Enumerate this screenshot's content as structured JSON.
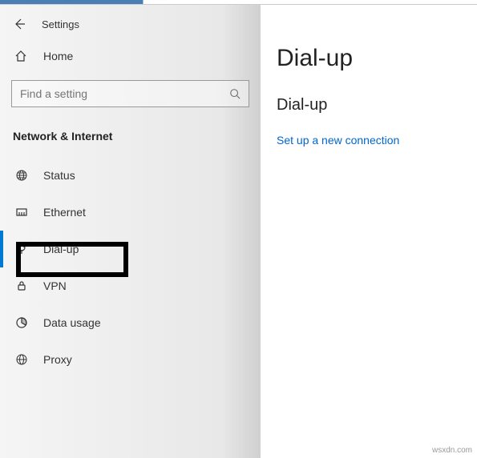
{
  "header": {
    "app_title": "Settings"
  },
  "home": {
    "label": "Home"
  },
  "search": {
    "placeholder": "Find a setting"
  },
  "section": {
    "title": "Network & Internet"
  },
  "nav": {
    "items": [
      {
        "label": "Status"
      },
      {
        "label": "Ethernet"
      },
      {
        "label": "Dial-up"
      },
      {
        "label": "VPN"
      },
      {
        "label": "Data usage"
      },
      {
        "label": "Proxy"
      }
    ]
  },
  "content": {
    "page_title": "Dial-up",
    "sub_heading": "Dial-up",
    "link_text": "Set up a new connection"
  },
  "watermark": "wsxdn.com"
}
